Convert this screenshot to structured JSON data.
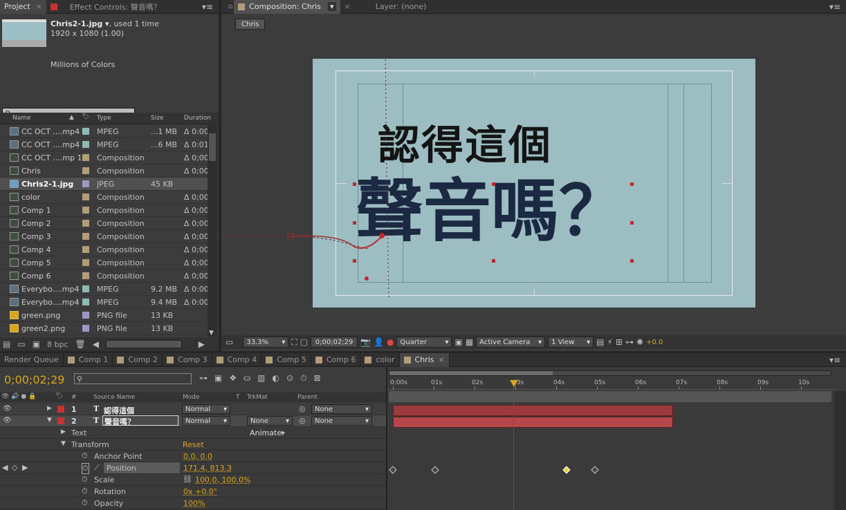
{
  "project": {
    "tabs": [
      "Project",
      "Effect Controls: 聲音嗎？"
    ],
    "file_name": "Chris2-1.jpg ▾",
    "used": ", used 1 time",
    "dims": "1920 x 1080 (1.00)",
    "colors": "Millions of Colors",
    "search_placeholder": "",
    "cols": [
      "Name",
      "Type",
      "Size",
      "Duration"
    ],
    "items": [
      {
        "name": "CC OCT ....mp4",
        "type": "MPEG",
        "size": "...1 MB",
        "dur": "Δ 0:00",
        "sw": "#8fb9b4",
        "kind": "video"
      },
      {
        "name": "CC OCT ....mp4",
        "type": "MPEG",
        "size": "...6 MB",
        "dur": "Δ 0:01",
        "sw": "#8fb9b4",
        "kind": "video"
      },
      {
        "name": "CC OCT ....mp 1",
        "type": "Composition",
        "size": "",
        "dur": "Δ 0;00",
        "sw": "#b59c78",
        "kind": "comp"
      },
      {
        "name": "Chris",
        "type": "Composition",
        "size": "",
        "dur": "Δ 0;00",
        "sw": "#b59c78",
        "kind": "comp"
      },
      {
        "name": "Chris2-1.jpg",
        "type": "JPEG",
        "size": "45 KB",
        "dur": "",
        "sw": "#9a98c8",
        "kind": "image",
        "selected": true
      },
      {
        "name": "color",
        "type": "Composition",
        "size": "",
        "dur": "Δ 0;00",
        "sw": "#b59c78",
        "kind": "comp"
      },
      {
        "name": "Comp 1",
        "type": "Composition",
        "size": "",
        "dur": "Δ 0;00",
        "sw": "#b59c78",
        "kind": "comp"
      },
      {
        "name": "Comp 2",
        "type": "Composition",
        "size": "",
        "dur": "Δ 0;00",
        "sw": "#b59c78",
        "kind": "comp"
      },
      {
        "name": "Comp 3",
        "type": "Composition",
        "size": "",
        "dur": "Δ 0;00",
        "sw": "#b59c78",
        "kind": "comp"
      },
      {
        "name": "Comp 4",
        "type": "Composition",
        "size": "",
        "dur": "Δ 0;00",
        "sw": "#b59c78",
        "kind": "comp"
      },
      {
        "name": "Comp 5",
        "type": "Composition",
        "size": "",
        "dur": "Δ 0;00",
        "sw": "#b59c78",
        "kind": "comp"
      },
      {
        "name": "Comp 6",
        "type": "Composition",
        "size": "",
        "dur": "Δ 0;00",
        "sw": "#b59c78",
        "kind": "comp"
      },
      {
        "name": "Everybo....mp4",
        "type": "MPEG",
        "size": "9.2 MB",
        "dur": "Δ 0:00",
        "sw": "#8fb9b4",
        "kind": "video"
      },
      {
        "name": "Everybo....mp4",
        "type": "MPEG",
        "size": "9.4 MB",
        "dur": "Δ 0:00",
        "sw": "#8fb9b4",
        "kind": "video"
      },
      {
        "name": "green.png",
        "type": "PNG file",
        "size": "13 KB",
        "dur": "",
        "sw": "#9a98c8",
        "kind": "png"
      },
      {
        "name": "green2.png",
        "type": "PNG file",
        "size": "13 KB",
        "dur": "",
        "sw": "#9a98c8",
        "kind": "png"
      }
    ],
    "bpc": "8 bpc"
  },
  "comp": {
    "tabs": [
      "Composition: Chris",
      "Layer: (none)"
    ],
    "crumb": "Chris",
    "line1": "認得這個",
    "line2": "聲音嗎？",
    "zoom": "33.3%",
    "time": "0;00;02;29",
    "resolution": "Quarter",
    "camera": "Active Camera",
    "view": "1 View",
    "exposure": "+0.0"
  },
  "timeline": {
    "tabs": [
      "Render Queue",
      "Comp 1",
      "Comp 2",
      "Comp 3",
      "Comp 4",
      "Comp 5",
      "Comp 6",
      "color",
      "Chris"
    ],
    "timecode": "0;00;02;29",
    "cols": [
      "#",
      "Source Name",
      "Mode",
      "T",
      "TrkMat",
      "Parent"
    ],
    "ruler": [
      "0:00s",
      "01s",
      "02s",
      "03s",
      "04s",
      "05s",
      "06s",
      "07s",
      "08s",
      "09s",
      "10s"
    ],
    "layers": [
      {
        "num": "1",
        "name": "認得這個",
        "mode": "Normal",
        "trkmat": "",
        "parent": "None"
      },
      {
        "num": "2",
        "name": "聲音嗎？",
        "mode": "Normal",
        "trkmat": "None",
        "parent": "None"
      }
    ],
    "props": {
      "text": "Text",
      "animate": "Animate:",
      "transform": "Transform",
      "reset": "Reset",
      "anchor": "Anchor Point",
      "anchor_val": "0.0, 0.0",
      "position": "Position",
      "position_val": "171.4, 813.3",
      "scale": "Scale",
      "scale_val": "100.0, 100.0%",
      "rotation": "Rotation",
      "rotation_val": "0x +0.0°",
      "opacity": "Opacity",
      "opacity_val": "100%"
    },
    "colors": {
      "label_red": "#c83232",
      "bar1": "#9c3a3d",
      "bar2": "#b5474b",
      "playhead": "#e0201e",
      "accent": "#d9a51c"
    }
  }
}
